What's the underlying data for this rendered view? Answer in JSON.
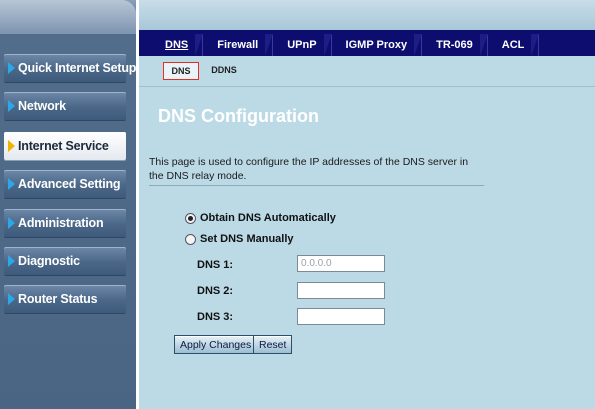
{
  "sidebar": {
    "items": [
      {
        "label": "Quick Internet Setup",
        "active": false
      },
      {
        "label": "Network",
        "active": false
      },
      {
        "label": "Internet Service",
        "active": true
      },
      {
        "label": "Advanced Setting",
        "active": false
      },
      {
        "label": "Administration",
        "active": false
      },
      {
        "label": "Diagnostic",
        "active": false
      },
      {
        "label": "Router Status",
        "active": false
      }
    ]
  },
  "tabs": [
    {
      "label": "DNS",
      "active": true
    },
    {
      "label": "Firewall",
      "active": false
    },
    {
      "label": "UPnP",
      "active": false
    },
    {
      "label": "IGMP Proxy",
      "active": false
    },
    {
      "label": "TR-069",
      "active": false
    },
    {
      "label": "ACL",
      "active": false
    }
  ],
  "subtabs": [
    {
      "label": "DNS",
      "active": true
    },
    {
      "label": "DDNS",
      "active": false
    }
  ],
  "page": {
    "title": "DNS Configuration",
    "description": "This page is used to configure the IP addresses of the DNS server in the DNS relay mode."
  },
  "form": {
    "option_auto": "Obtain DNS Automatically",
    "option_manual": "Set DNS Manually",
    "selected": "auto",
    "dns1_label": "DNS 1:",
    "dns1_value": "0.0.0.0",
    "dns2_label": "DNS 2:",
    "dns2_value": "",
    "dns3_label": "DNS 3:",
    "dns3_value": "",
    "apply_label": "Apply Changes",
    "reset_label": "Reset"
  },
  "colors": {
    "tab_bar": "#0d0d70",
    "content_bg": "#bcdae6",
    "active_arrow": "#f0b400",
    "arrow": "#2aa8e8"
  }
}
